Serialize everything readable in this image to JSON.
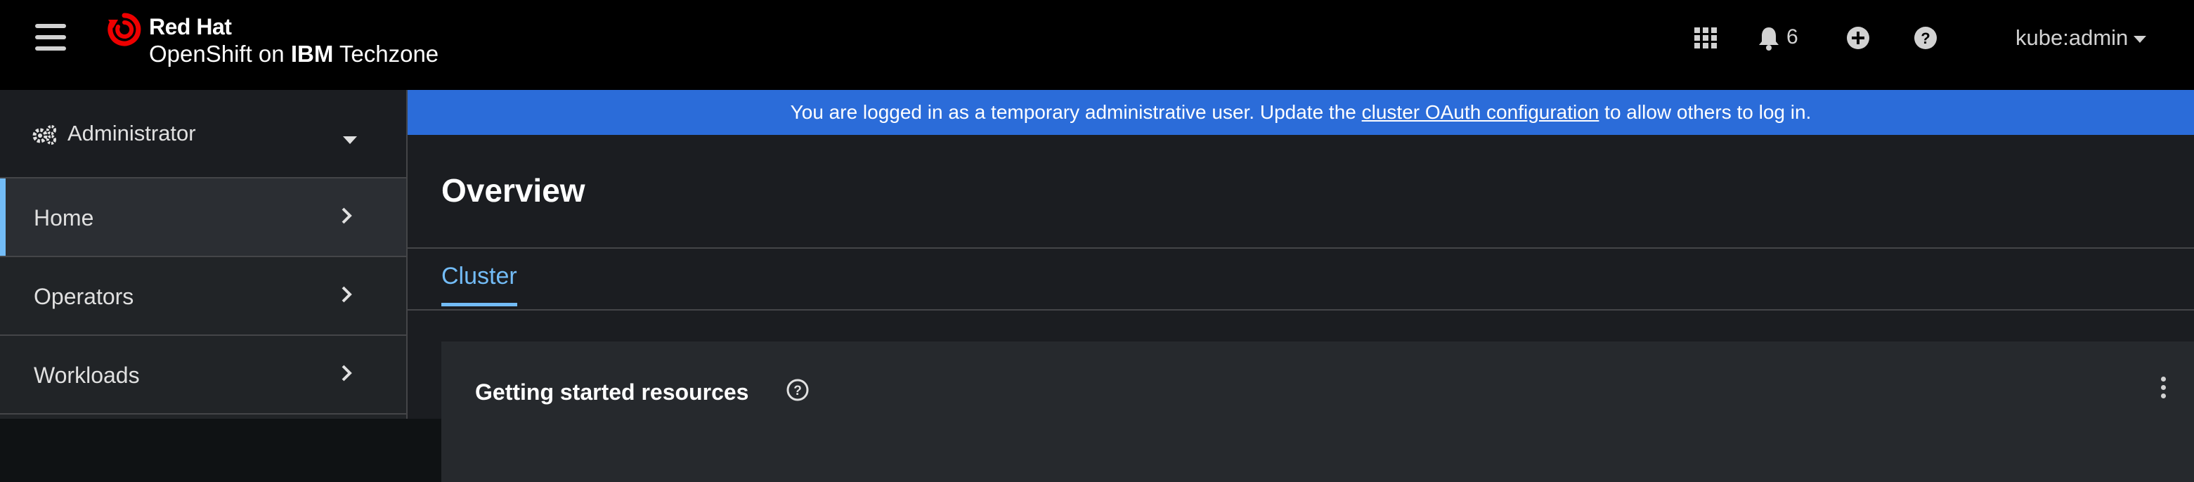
{
  "masthead": {
    "brand_name": "Red Hat",
    "product_prefix": "OpenShift on ",
    "product_bold": "IBM",
    "product_suffix": " Techzone",
    "notification_count": "6",
    "user": "kube:admin",
    "icons": [
      "hamburger-icon",
      "app-launcher-icon",
      "bell-icon",
      "plus-circle-icon",
      "help-circle-icon",
      "caret-down-icon"
    ]
  },
  "sidebar": {
    "perspective": "Administrator",
    "items": [
      {
        "label": "Home",
        "active": true
      },
      {
        "label": "Operators",
        "active": false
      },
      {
        "label": "Workloads",
        "active": false
      }
    ]
  },
  "banner": {
    "text_before": "You are logged in as a temporary administrative user. Update the ",
    "link": "cluster OAuth configuration",
    "text_after": " to allow others to log in."
  },
  "page": {
    "title": "Overview",
    "tabs": [
      "Cluster"
    ]
  },
  "card": {
    "title": "Getting started resources"
  },
  "colors": {
    "banner": "#2b6cd9",
    "accent": "#73bcf7",
    "masthead": "#000000"
  }
}
